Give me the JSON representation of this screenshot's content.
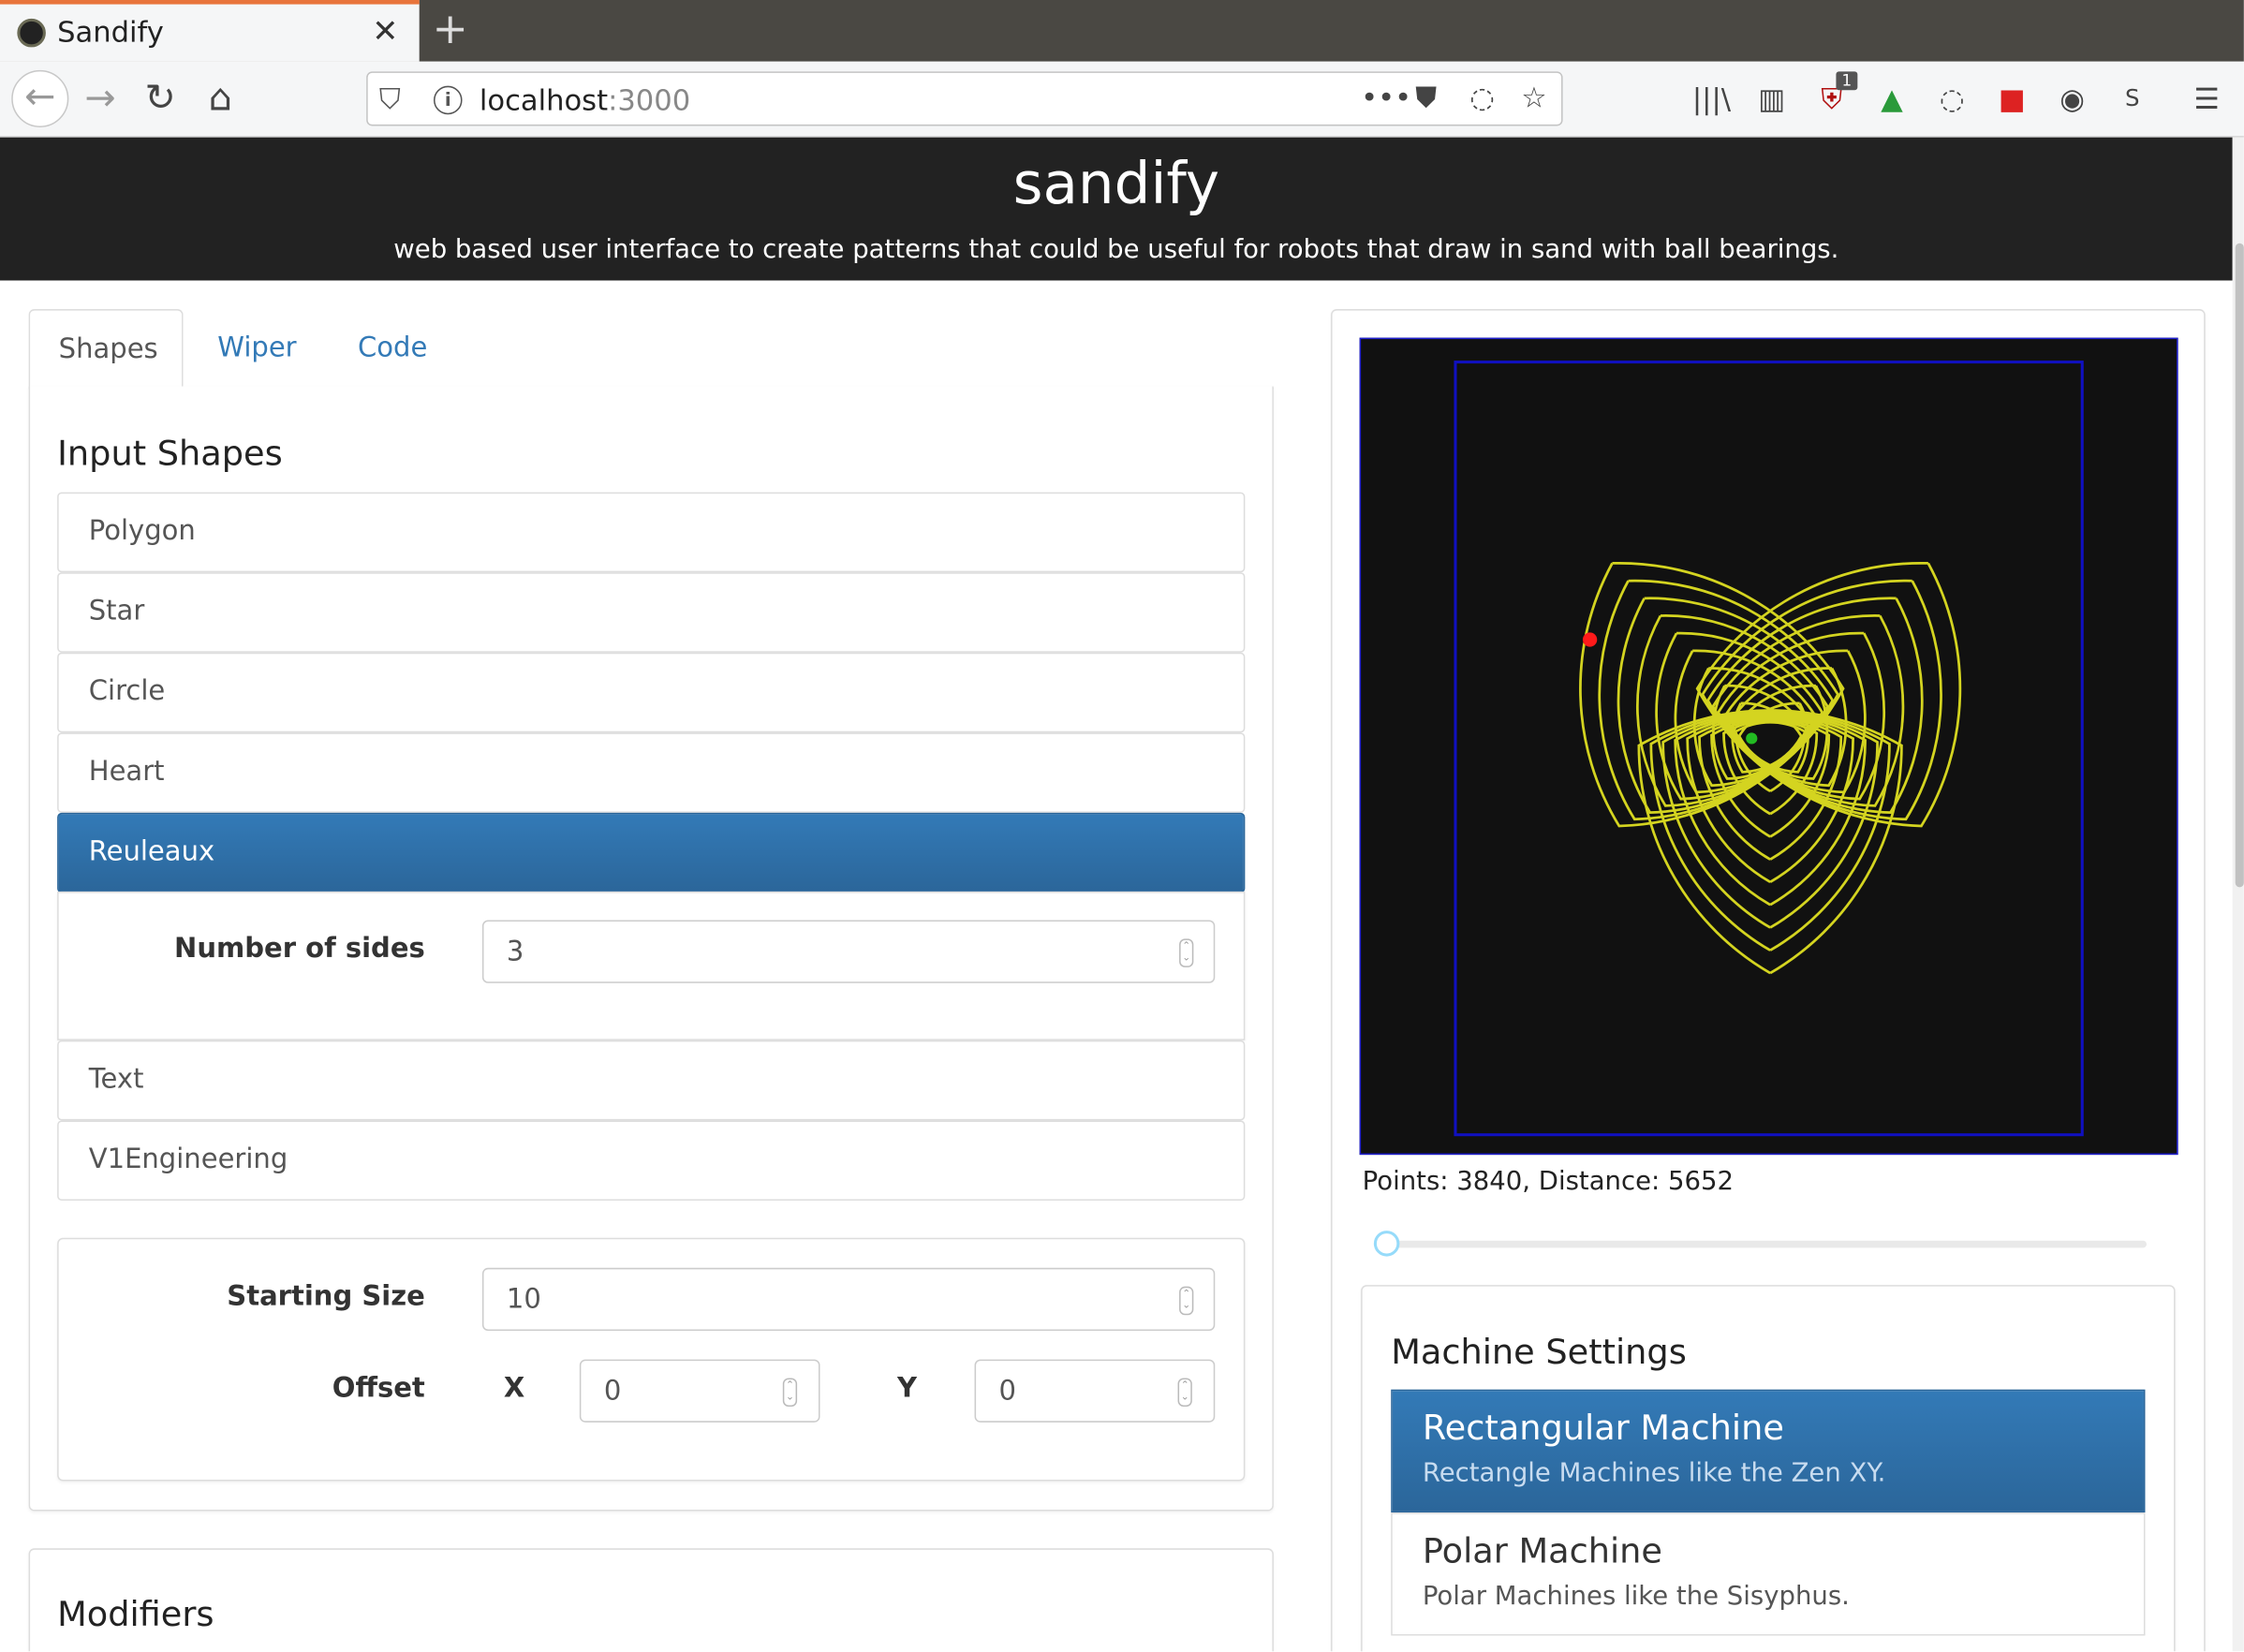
{
  "browser": {
    "tab_title": "Sandify",
    "tab_close": "✕",
    "new_tab": "+",
    "url_host": "localhost",
    "url_port": ":3000",
    "toolbar_badge": "1"
  },
  "header": {
    "title": "sandify",
    "subtitle": "web based user interface to create patterns that could be useful for robots that draw in sand with ball bearings."
  },
  "tabs": [
    {
      "label": "Shapes",
      "active": true
    },
    {
      "label": "Wiper",
      "active": false
    },
    {
      "label": "Code",
      "active": false
    }
  ],
  "input_shapes": {
    "heading": "Input Shapes",
    "items": [
      "Polygon",
      "Star",
      "Circle",
      "Heart",
      "Reuleaux",
      "Text",
      "V1Engineering"
    ],
    "selected": "Reuleaux",
    "number_of_sides_label": "Number of sides",
    "number_of_sides_value": "3"
  },
  "transform": {
    "starting_size_label": "Starting Size",
    "starting_size_value": "10",
    "offset_label": "Offset",
    "x_label": "X",
    "x_value": "0",
    "y_label": "Y",
    "y_value": "0"
  },
  "modifiers": {
    "heading": "Modifiers"
  },
  "preview": {
    "stats": "Points: 3840, Distance: 5652",
    "background_color": "#111111",
    "machine_border_color": "#1010c0",
    "path_color": "#d4d420",
    "start_dot_color": "#ff1a1a",
    "end_dot_color": "#22bb22",
    "slider_fraction": 0.0
  },
  "machine_settings": {
    "heading": "Machine Settings",
    "machines": [
      {
        "title": "Rectangular Machine",
        "desc": "Rectangle Machines like the Zen XY.",
        "active": true
      },
      {
        "title": "Polar Machine",
        "desc": "Polar Machines like the Sisyphus.",
        "active": false
      }
    ]
  },
  "colors": {
    "accent": "#337ab7",
    "link": "#337ab7",
    "header_bg": "#222222"
  }
}
